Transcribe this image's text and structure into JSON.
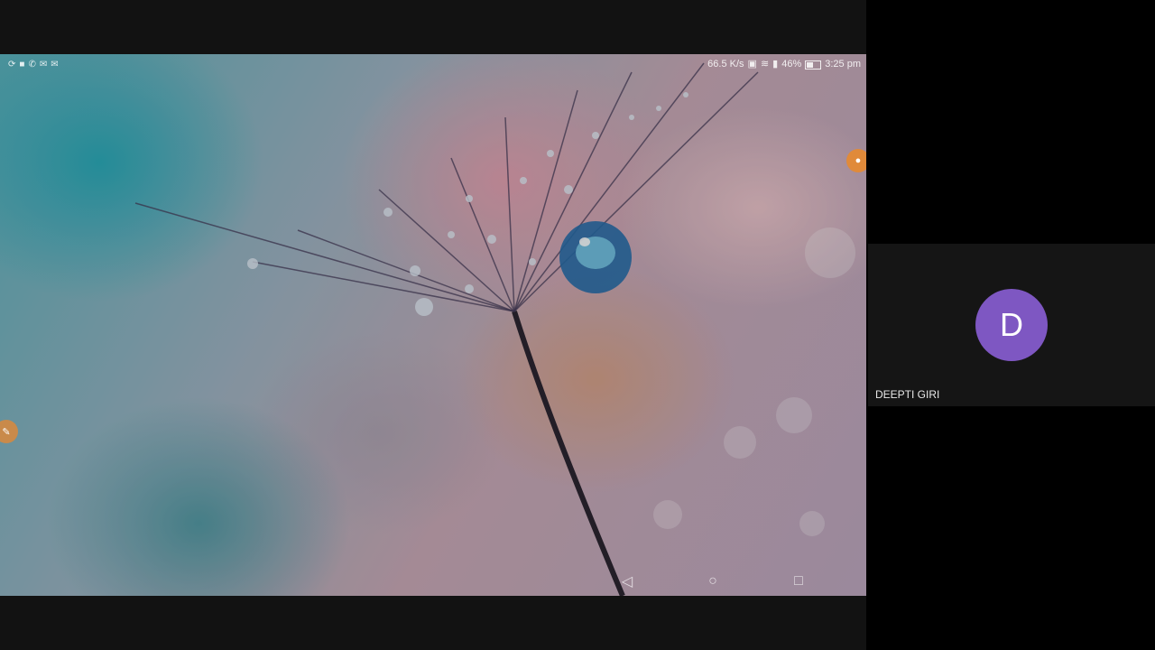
{
  "statusbar": {
    "left_icons": [
      "sync-icon",
      "video-icon",
      "phone-icon",
      "mail-icon",
      "mail-icon"
    ],
    "net_speed": "66.5 K/s",
    "battery_percent": "46%",
    "time": "3:25 pm"
  },
  "navbar": {
    "back_glyph": "◁",
    "home_glyph": "○",
    "recents_glyph": "□"
  },
  "participant": {
    "initial": "D",
    "name": "DEEPTI GIRI",
    "avatar_color": "#7e57c2"
  }
}
